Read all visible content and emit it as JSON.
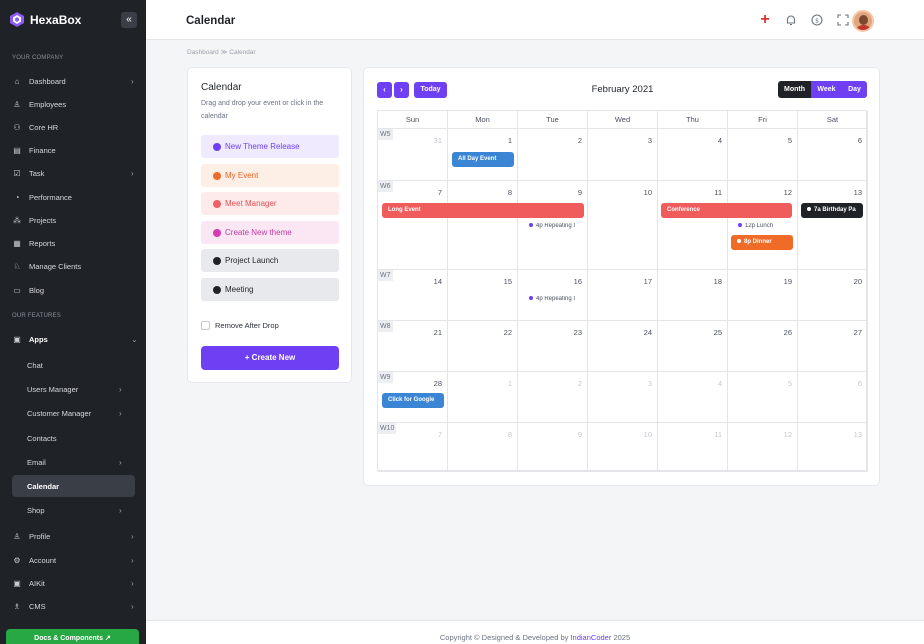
{
  "brand": {
    "name": "HexaBox"
  },
  "sidebar": {
    "section_company": "YOUR COMPANY",
    "section_features": "OUR FEATURES",
    "company_items": [
      {
        "label": "Dashboard",
        "icon": "home-icon"
      },
      {
        "label": "Employees",
        "icon": "users-icon"
      },
      {
        "label": "Core HR",
        "icon": "user-cog-icon"
      },
      {
        "label": "Finance",
        "icon": "document-icon"
      },
      {
        "label": "Task",
        "icon": "task-icon"
      },
      {
        "label": "Performance",
        "icon": "gauge-icon"
      },
      {
        "label": "Projects",
        "icon": "projects-icon"
      },
      {
        "label": "Reports",
        "icon": "report-icon"
      },
      {
        "label": "Manage Clients",
        "icon": "client-icon"
      },
      {
        "label": "Blog",
        "icon": "blog-icon"
      }
    ],
    "apps_label": "Apps",
    "apps_items": [
      {
        "label": "Chat"
      },
      {
        "label": "Users Manager"
      },
      {
        "label": "Customer Manager"
      },
      {
        "label": "Contacts"
      },
      {
        "label": "Email"
      },
      {
        "label": "Calendar"
      },
      {
        "label": "Shop"
      }
    ],
    "bottom_items": [
      {
        "label": "Profile",
        "icon": "profile-icon"
      },
      {
        "label": "Account",
        "icon": "gear-icon"
      },
      {
        "label": "AIKit",
        "icon": "chip-icon"
      },
      {
        "label": "CMS",
        "icon": "cms-icon"
      }
    ],
    "docs_button": "Docs & Components ↗"
  },
  "header": {
    "title": "Calendar"
  },
  "breadcrumb": {
    "home": "Dashboard",
    "sep": "≫",
    "current": "Calendar"
  },
  "events_panel": {
    "title": "Calendar",
    "description": "Drag and drop your event or click in the calendar",
    "events": [
      {
        "label": "New Theme Release",
        "bg": "#efeafd",
        "dot": "#6e3ff3",
        "color": "#6e3ff3"
      },
      {
        "label": "My Event",
        "bg": "#fdeee6",
        "dot": "#f06a28",
        "color": "#e8651f"
      },
      {
        "label": "Meet Manager",
        "bg": "#fdeaea",
        "dot": "#f06060",
        "color": "#e05252"
      },
      {
        "label": "Create New theme",
        "bg": "#fbe7f4",
        "dot": "#d63bb2",
        "color": "#c23aa3"
      },
      {
        "label": "Project Launch",
        "bg": "#e8e9ec",
        "dot": "#1f2328",
        "color": "#1f2328"
      },
      {
        "label": "Meeting",
        "bg": "#e8e9ec",
        "dot": "#1f2328",
        "color": "#1f2328"
      }
    ],
    "remove_after_drop": "Remove After Drop",
    "create_new": "+ Create New"
  },
  "calendar": {
    "prev": "‹",
    "next": "›",
    "today": "Today",
    "month_title": "February 2021",
    "views": [
      "Month",
      "Week",
      "Day"
    ],
    "active_view": "Month",
    "weekdays": [
      "Sun",
      "Mon",
      "Tue",
      "Wed",
      "Thu",
      "Fri",
      "Sat"
    ],
    "weeks": [
      {
        "label": "W5",
        "days": [
          "31",
          "1",
          "2",
          "3",
          "4",
          "5",
          "6"
        ],
        "other": [
          true,
          false,
          false,
          false,
          false,
          false,
          false
        ]
      },
      {
        "label": "W6",
        "days": [
          "7",
          "8",
          "9",
          "10",
          "11",
          "12",
          "13"
        ],
        "other": [
          false,
          false,
          false,
          false,
          false,
          false,
          false
        ]
      },
      {
        "label": "W7",
        "days": [
          "14",
          "15",
          "16",
          "17",
          "18",
          "19",
          "20"
        ],
        "other": [
          false,
          false,
          false,
          false,
          false,
          false,
          false
        ]
      },
      {
        "label": "W8",
        "days": [
          "21",
          "22",
          "23",
          "24",
          "25",
          "26",
          "27"
        ],
        "other": [
          false,
          false,
          false,
          false,
          false,
          false,
          false
        ]
      },
      {
        "label": "W9",
        "days": [
          "28",
          "1",
          "2",
          "3",
          "4",
          "5",
          "6"
        ],
        "other": [
          false,
          true,
          true,
          true,
          true,
          true,
          true
        ]
      },
      {
        "label": "W10",
        "days": [
          "7",
          "8",
          "9",
          "10",
          "11",
          "12",
          "13"
        ],
        "other": [
          true,
          true,
          true,
          true,
          true,
          true,
          true
        ]
      }
    ],
    "events": {
      "all_day": "All Day Event",
      "long_event": "Long Event",
      "conference": "Conference",
      "birthday": "7a Birthday Pa",
      "repeating_1": "4p Repeating I",
      "repeating_2": "4p Repeating I",
      "lunch": "12p Lunch",
      "dinner": "8p Dinner",
      "google": "Click for Google"
    },
    "colors": {
      "blue": "#3a86d4",
      "red": "#f05b5b",
      "dark": "#1f2328",
      "orange": "#f06a28",
      "purple": "#6e3ff3"
    }
  },
  "footer": {
    "prefix": "Copyright © Designed & Developed by",
    "link": "IndianCoder",
    "year": "2025"
  }
}
